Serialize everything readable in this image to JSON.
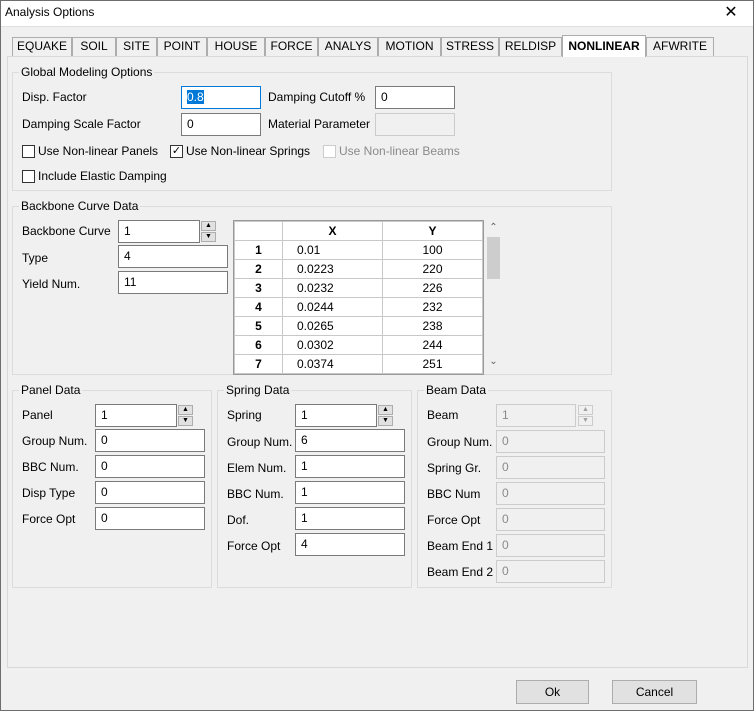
{
  "window": {
    "title": "Analysis Options",
    "close_glyph": "✕"
  },
  "tabs": [
    "EQUAKE",
    "SOIL",
    "SITE",
    "POINT",
    "HOUSE",
    "FORCE",
    "ANALYS",
    "MOTION",
    "STRESS",
    "RELDISP",
    "NONLINEAR",
    "AFWRITE"
  ],
  "active_tab": "NONLINEAR",
  "global": {
    "title": "Global Modeling Options",
    "disp_factor_label": "Disp. Factor",
    "disp_factor_value": "0.8",
    "damping_cutoff_label": "Damping Cutoff %",
    "damping_cutoff_value": "0",
    "damping_scale_label": "Damping Scale Factor",
    "damping_scale_value": "0",
    "material_param_label": "Material Parameter",
    "material_param_value": "",
    "nl_panels_label": "Use Non-linear Panels",
    "nl_panels_checked": false,
    "nl_springs_label": "Use Non-linear Springs",
    "nl_springs_checked": true,
    "nl_beams_label": "Use Non-linear Beams",
    "nl_beams_checked": false,
    "elastic_damping_label": "Include Elastic Damping",
    "elastic_damping_checked": false,
    "check_glyph": "✓"
  },
  "backbone": {
    "title": "Backbone Curve Data",
    "curve_label": "Backbone Curve",
    "curve_value": "1",
    "type_label": "Type",
    "type_value": "4",
    "yield_label": "Yield Num.",
    "yield_value": "11",
    "table": {
      "headers": [
        "X",
        "Y"
      ],
      "rows": [
        {
          "n": "1",
          "x": "0.01",
          "y": "100"
        },
        {
          "n": "2",
          "x": "0.0223",
          "y": "220"
        },
        {
          "n": "3",
          "x": "0.0232",
          "y": "226"
        },
        {
          "n": "4",
          "x": "0.0244",
          "y": "232"
        },
        {
          "n": "5",
          "x": "0.0265",
          "y": "238"
        },
        {
          "n": "6",
          "x": "0.0302",
          "y": "244"
        },
        {
          "n": "7",
          "x": "0.0374",
          "y": "251"
        }
      ]
    }
  },
  "panel": {
    "title": "Panel Data",
    "panel_label": "Panel",
    "panel_value": "1",
    "group_label": "Group Num.",
    "group_value": "0",
    "bbc_label": "BBC Num.",
    "bbc_value": "0",
    "disp_type_label": "Disp Type",
    "disp_type_value": "0",
    "force_opt_label": "Force Opt",
    "force_opt_value": "0"
  },
  "spring": {
    "title": "Spring Data",
    "spring_label": "Spring",
    "spring_value": "1",
    "group_label": "Group Num.",
    "group_value": "6",
    "elem_label": "Elem Num.",
    "elem_value": "1",
    "bbc_label": "BBC Num.",
    "bbc_value": "1",
    "dof_label": "Dof.",
    "dof_value": "1",
    "force_opt_label": "Force Opt",
    "force_opt_value": "4"
  },
  "beam": {
    "title": "Beam Data",
    "beam_label": "Beam",
    "beam_value": "1",
    "group_label": "Group Num.",
    "group_value": "0",
    "spring_gr_label": "Spring Gr.",
    "spring_gr_value": "0",
    "bbc_label": "BBC Num",
    "bbc_value": "0",
    "force_opt_label": "Force Opt",
    "force_opt_value": "0",
    "end1_label": "Beam End 1",
    "end1_value": "0",
    "end2_label": "Beam End 2",
    "end2_value": "0"
  },
  "buttons": {
    "ok": "Ok",
    "cancel": "Cancel"
  },
  "icons": {
    "spin_up": "▲",
    "spin_down": "▼",
    "scroll_up": "⌃",
    "scroll_down": "⌄"
  }
}
